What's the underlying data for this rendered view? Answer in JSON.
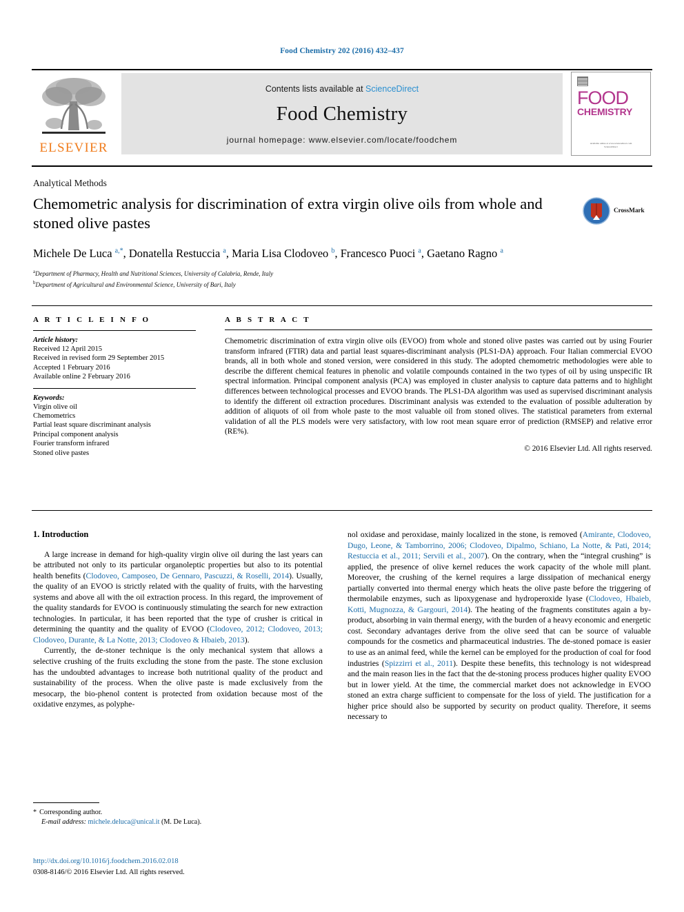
{
  "running_head": "Food Chemistry 202 (2016) 432–437",
  "masthead": {
    "contents_prefix": "Contents lists available at ",
    "sciencedirect": "ScienceDirect",
    "journal_name": "Food Chemistry",
    "homepage": "journal homepage: www.elsevier.com/locate/foodchem",
    "publisher": "ELSEVIER",
    "cover": {
      "word_food": "FOOD",
      "word_chemistry": "CHEMISTRY",
      "footer_line1": "Available online at www.sciencedirect.com",
      "footer_line2": "ScienceDirect"
    },
    "colors": {
      "link": "#2a8fd0",
      "elsevier_orange": "#f07c1c",
      "cover_magenta": "#b3368d",
      "band": "#e3e3e3"
    }
  },
  "article": {
    "section_label": "Analytical Methods",
    "title": "Chemometric analysis for discrimination of extra virgin olive oils from whole and stoned olive pastes",
    "crossmark_label": "CrossMark",
    "authors_html": "Michele De Luca <sup class=\"star\">a,*</sup>, Donatella Restuccia <sup>a</sup>, Maria Lisa Clodoveo <sup>b</sup>, Francesco Puoci <sup>a</sup>, Gaetano Ragno <sup>a</sup>",
    "affiliations": [
      {
        "marker": "a",
        "text": "Department of Pharmacy, Health and Nutritional Sciences, University of Calabria, Rende, Italy"
      },
      {
        "marker": "b",
        "text": "Department of Agricultural and Environmental Science, University of Bari, Italy"
      }
    ]
  },
  "article_info": {
    "heading": "A R T I C L E   I N F O",
    "history_label": "Article history:",
    "history": [
      "Received 12 April 2015",
      "Received in revised form 29 September 2015",
      "Accepted 1 February 2016",
      "Available online 2 February 2016"
    ],
    "keywords_label": "Keywords:",
    "keywords": [
      "Virgin olive oil",
      "Chemometrics",
      "Partial least square discriminant analysis",
      "Principal component analysis",
      "Fourier transform infrared",
      "Stoned olive pastes"
    ]
  },
  "abstract": {
    "heading": "A B S T R A C T",
    "body": "Chemometric discrimination of extra virgin olive oils (EVOO) from whole and stoned olive pastes was carried out by using Fourier transform infrared (FTIR) data and partial least squares-discriminant analysis (PLS1-DA) approach. Four Italian commercial EVOO brands, all in both whole and stoned version, were considered in this study. The adopted chemometric methodologies were able to describe the different chemical features in phenolic and volatile compounds contained in the two types of oil by using unspecific IR spectral information. Principal component analysis (PCA) was employed in cluster analysis to capture data patterns and to highlight differences between technological processes and EVOO brands. The PLS1-DA algorithm was used as supervised discriminant analysis to identify the different oil extraction procedures. Discriminant analysis was extended to the evaluation of possible adulteration by addition of aliquots of oil from whole paste to the most valuable oil from stoned olives. The statistical parameters from external validation of all the PLS models were very satisfactory, with low root mean square error of prediction (RMSEP) and relative error (RE%).",
    "copyright": "© 2016 Elsevier Ltd. All rights reserved."
  },
  "introduction": {
    "heading": "1. Introduction",
    "left_paragraph_1_a": "A large increase in demand for high-quality virgin olive oil during the last years can be attributed not only to its particular organoleptic properties but also to its potential health benefits (",
    "left_cite_1": "Clodoveo, Camposeo, De Gennaro, Pascuzzi, & Roselli, 2014",
    "left_paragraph_1_b": "). Usually, the quality of an EVOO is strictly related with the quality of fruits, with the harvesting systems and above all with the oil extraction process. In this regard, the improvement of the quality standards for EVOO is continuously stimulating the search for new extraction technologies. In particular, it has been reported that the type of crusher is critical in determining the quantity and the quality of EVOO (",
    "left_cite_2": "Clodoveo, 2012; Clodoveo, 2013; Clodoveo, Durante, & La Notte, 2013; Clodoveo & Hbaieb, 2013",
    "left_paragraph_1_c": ").",
    "left_paragraph_2": "Currently, the de-stoner technique is the only mechanical system that allows a selective crushing of the fruits excluding the stone from the paste. The stone exclusion has the undoubted advantages to increase both nutritional quality of the product and sustainability of the process. When the olive paste is made exclusively from the mesocarp, the bio-phenol content is protected from oxidation because most of the oxidative enzymes, as polyphe-",
    "right_text_a": "nol oxidase and peroxidase, mainly localized in the stone, is removed (",
    "right_cite_1": "Amirante, Clodoveo, Dugo, Leone, & Tamborrino, 2006; Clodoveo, Dipalmo, Schiano, La Notte, & Pati, 2014; Restuccia et al., 2011; Servili et al., 2007",
    "right_text_b": "). On the contrary, when the “integral crushing” is applied, the presence of olive kernel reduces the work capacity of the whole mill plant. Moreover, the crushing of the kernel requires a large dissipation of mechanical energy partially converted into thermal energy which heats the olive paste before the triggering of thermolabile enzymes, such as lipoxygenase and hydroperoxide lyase (",
    "right_cite_2": "Clodoveo, Hbaieb, Kotti, Mugnozza, & Gargouri, 2014",
    "right_text_c": "). The heating of the fragments constitutes again a by-product, absorbing in vain thermal energy, with the burden of a heavy economic and energetic cost. Secondary advantages derive from the olive seed that can be source of valuable compounds for the cosmetics and pharmaceutical industries. The de-stoned pomace is easier to use as an animal feed, while the kernel can be employed for the production of coal for food industries (",
    "right_cite_3": "Spizzirri et al., 2011",
    "right_text_d": "). Despite these benefits, this technology is not widespread and the main reason lies in the fact that the de-stoning process produces higher quality EVOO but in lower yield. At the time, the commercial market does not acknowledge in EVOO stoned an extra charge sufficient to compensate for the loss of yield. The justification for a higher price should also be supported by security on product quality. Therefore, it seems necessary to"
  },
  "footer": {
    "corresponding_star": "*",
    "corresponding_label": "Corresponding author.",
    "email_label": "E-mail address:",
    "email": "michele.deluca@unical.it",
    "email_suffix": "(M. De Luca).",
    "doi": "http://dx.doi.org/10.1016/j.foodchem.2016.02.018",
    "issn": "0308-8146/© 2016 Elsevier Ltd. All rights reserved."
  }
}
